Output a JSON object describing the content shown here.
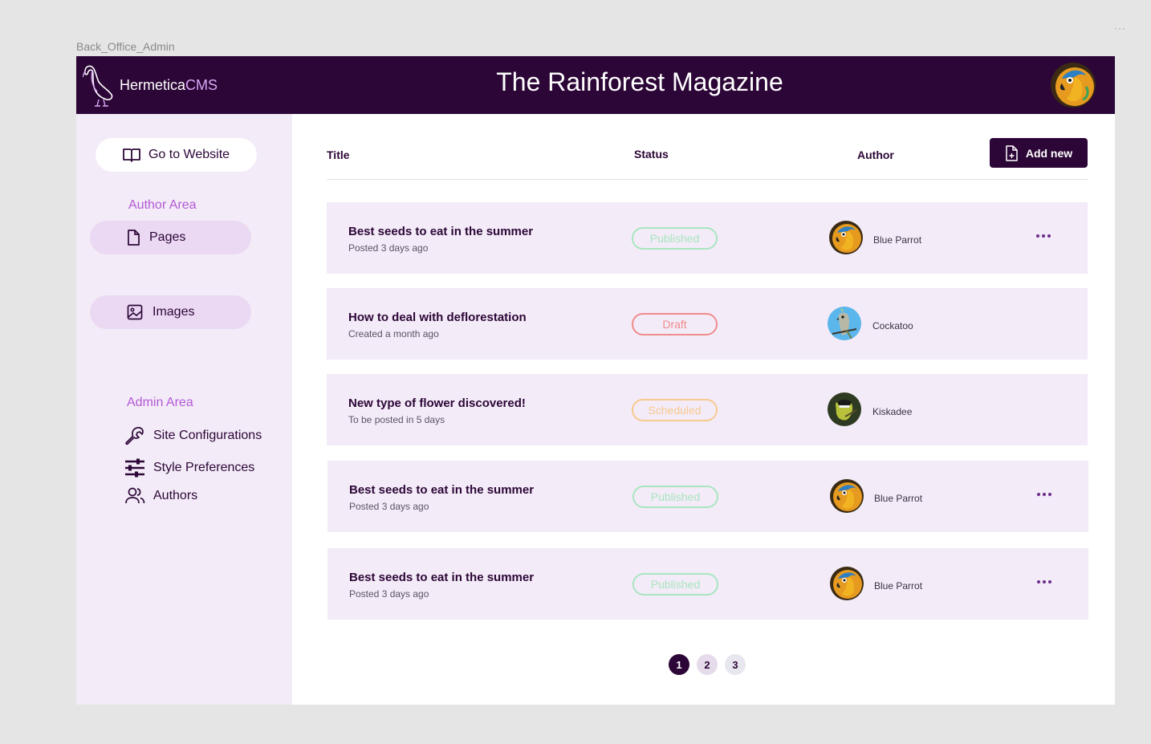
{
  "frame": {
    "label": "Back_Office_Admin",
    "menu": "···"
  },
  "header": {
    "brand_prefix": "Hermetica",
    "brand_suffix": "CMS",
    "title": "The Rainforest Magazine",
    "avatar_icon": "parrot-avatar-icon"
  },
  "sidebar": {
    "goto_label": "Go to Website",
    "author_area_label": "Author Area",
    "author_items": [
      {
        "label": "Pages",
        "icon": "page-icon"
      },
      {
        "label": "Images",
        "icon": "image-icon"
      }
    ],
    "admin_area_label": "Admin Area",
    "admin_items": [
      {
        "label": "Site Configurations",
        "icon": "wrench-icon"
      },
      {
        "label": "Style Preferences",
        "icon": "sliders-icon"
      },
      {
        "label": "Authors",
        "icon": "users-icon"
      }
    ]
  },
  "table": {
    "col_title": "Title",
    "col_status": "Status",
    "col_author": "Author",
    "add_label": "Add new",
    "rows": [
      {
        "title": "Best seeds to eat in the summer",
        "sub": "Posted 3 days ago",
        "status": "Published",
        "author": "Blue Parrot"
      },
      {
        "title": "How to deal with deflorestation",
        "sub": "Created a month ago",
        "status": "Draft",
        "author": "Cockatoo"
      },
      {
        "title": "New type of flower discovered!",
        "sub": "To be posted in 5 days",
        "status": "Scheduled",
        "author": "Kiskadee"
      },
      {
        "title": "Best seeds to eat in the summer",
        "sub": "Posted 3 days ago",
        "status": "Published",
        "author": "Blue Parrot"
      },
      {
        "title": "Best seeds to eat in the summer",
        "sub": "Posted 3 days ago",
        "status": "Published",
        "author": "Blue Parrot"
      }
    ]
  },
  "pagination": {
    "pages": [
      "1",
      "2",
      "3"
    ],
    "current": "1"
  },
  "colors": {
    "brand_dark": "#2c0637",
    "sidebar_bg": "#f3ebf7",
    "accent": "#b35ad6",
    "published": "#a8e6c0",
    "draft": "#f08c8c",
    "scheduled": "#f7c98e"
  }
}
